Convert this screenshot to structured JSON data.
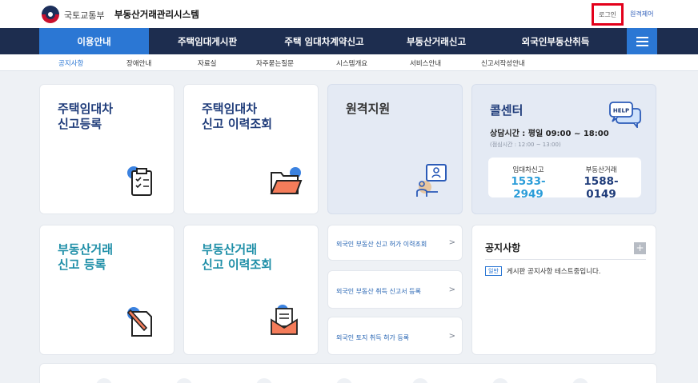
{
  "header": {
    "ministry": "국토교통부",
    "system_name": "부동산거래관리시스템",
    "login": "로그인",
    "remote": "원격제어"
  },
  "mainnav": {
    "items": [
      "이용안내",
      "주택임대게시판",
      "주택 임대차계약신고",
      "부동산거래신고",
      "외국인부동산취득"
    ]
  },
  "subnav": {
    "items": [
      "공지사항",
      "장애안내",
      "자료실",
      "자주묻는질문",
      "시스템개요",
      "서비스안내",
      "신고서작성안내"
    ]
  },
  "cards": {
    "rental_register": {
      "line1": "주택임대차",
      "line2": "신고등록"
    },
    "rental_history": {
      "line1": "주택임대차",
      "line2": "신고 이력조회"
    },
    "remote_support": {
      "title": "원격지원"
    },
    "callcenter": {
      "title": "콜센터",
      "hours": "상담시간 : 평일 09:00 ~ 18:00",
      "lunch": "(점심시간 : 12:00 ~ 13:00)",
      "help_label": "HELP",
      "rental_label": "임대차신고",
      "rental_num": "1533-2949",
      "trade_label": "부동산거래",
      "trade_num": "1588-0149"
    },
    "trade_register": {
      "line1": "부동산거래",
      "line2": "신고 등록"
    },
    "trade_history": {
      "line1": "부동산거래",
      "line2": "신고 이력조회"
    }
  },
  "links": [
    {
      "text": "외국인 부동산 신고 허가 이력조회",
      "chev": ">"
    },
    {
      "text": "외국인 부동산 취득 신고서 등록",
      "chev": ">"
    },
    {
      "text": "외국인 토지 취득 허가 등록",
      "chev": ">"
    }
  ],
  "notice": {
    "title": "공지사항",
    "plus": "+",
    "badge": "일반",
    "text": "게시판 공지사항 테스트중입니다."
  },
  "colors": {
    "nav": "#1d2d4f",
    "accent": "#2b77d4",
    "title_blue": "#1f3c7a",
    "title_teal": "#1f8fa8"
  }
}
